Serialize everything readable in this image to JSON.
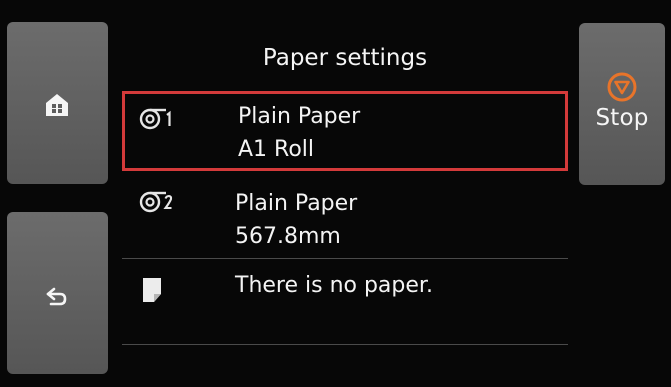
{
  "screen": {
    "title": "Paper settings"
  },
  "buttons": {
    "home": {
      "icon": "home-icon"
    },
    "back": {
      "icon": "back-arrow-icon"
    },
    "stop": {
      "label": "Stop",
      "icon": "stop-icon"
    }
  },
  "paper_sources": [
    {
      "icon": "roll-1-icon",
      "line1": "Plain Paper",
      "line2": "A1 Roll",
      "selected": true
    },
    {
      "icon": "roll-2-icon",
      "line1": "Plain Paper",
      "line2": "567.8mm",
      "selected": false
    },
    {
      "icon": "cut-sheet-icon",
      "line1": "There is no paper.",
      "line2": "",
      "selected": false
    }
  ],
  "colors": {
    "selection_border": "#d33a3a",
    "stop_accent": "#e8742a",
    "button_bg": "#5f5f5f"
  }
}
